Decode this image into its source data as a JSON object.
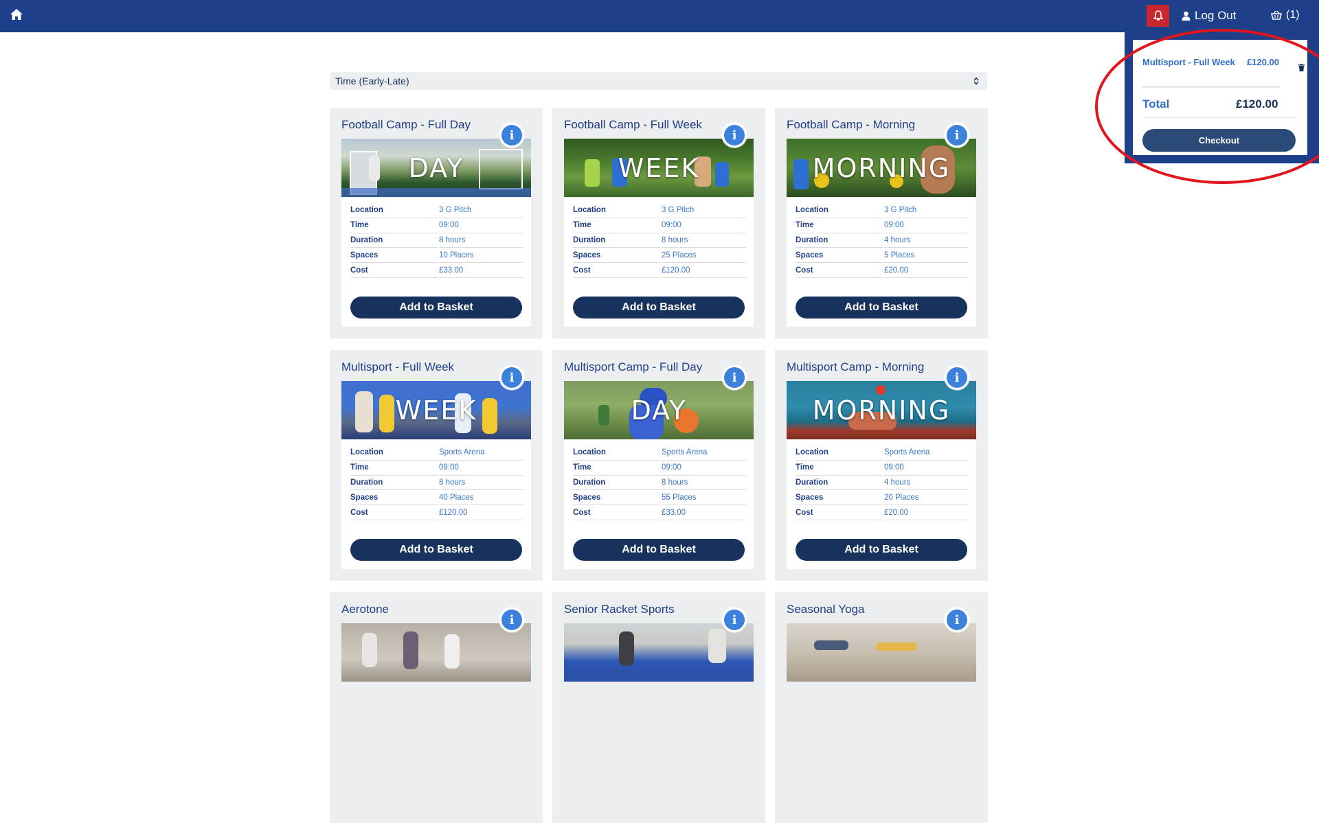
{
  "topbar": {
    "logout_label": "Log Out",
    "basket_count": "(1)"
  },
  "sort": {
    "selected": "Time (Early-Late)"
  },
  "detail_labels": {
    "location": "Location",
    "time": "Time",
    "duration": "Duration",
    "spaces": "Spaces",
    "cost": "Cost"
  },
  "add_label": "Add to Basket",
  "cards": [
    {
      "title": "Football Camp - Full Day",
      "overlay": "DAY",
      "location": "3 G Pitch",
      "time": "09:00",
      "duration": "8 hours",
      "spaces": "10 Places",
      "cost": "£33.00"
    },
    {
      "title": "Football Camp - Full Week",
      "overlay": "WEEK",
      "location": "3 G Pitch",
      "time": "09:00",
      "duration": "8 hours",
      "spaces": "25 Places",
      "cost": "£120.00"
    },
    {
      "title": "Football Camp - Morning",
      "overlay": "MORNING",
      "location": "3 G Pitch",
      "time": "09:00",
      "duration": "4 hours",
      "spaces": "5 Places",
      "cost": "£20.00"
    },
    {
      "title": "Multisport - Full Week",
      "overlay": "WEEK",
      "location": "Sports Arena",
      "time": "09:00",
      "duration": "8 hours",
      "spaces": "40 Places",
      "cost": "£120.00"
    },
    {
      "title": "Multisport Camp - Full Day",
      "overlay": "DAY",
      "location": "Sports Arena",
      "time": "09:00",
      "duration": "8 hours",
      "spaces": "55 Places",
      "cost": "£33.00"
    },
    {
      "title": "Multisport Camp - Morning",
      "overlay": "MORNING",
      "location": "Sports Arena",
      "time": "09:00",
      "duration": "4 hours",
      "spaces": "20 Places",
      "cost": "£20.00"
    },
    {
      "title": "Aerotone",
      "overlay": ""
    },
    {
      "title": "Senior Racket Sports",
      "overlay": ""
    },
    {
      "title": "Seasonal Yoga",
      "overlay": ""
    }
  ],
  "basket": {
    "item_name": "Multisport - Full Week",
    "item_price": "£120.00",
    "total_label": "Total",
    "total_value": "£120.00",
    "checkout_label": "Checkout"
  },
  "colors": {
    "topbar": "#1e3f8a",
    "navy": "#17325c",
    "link_blue": "#3a78c9",
    "alert_red": "#c9272d",
    "annotation_red": "#e0161c"
  }
}
